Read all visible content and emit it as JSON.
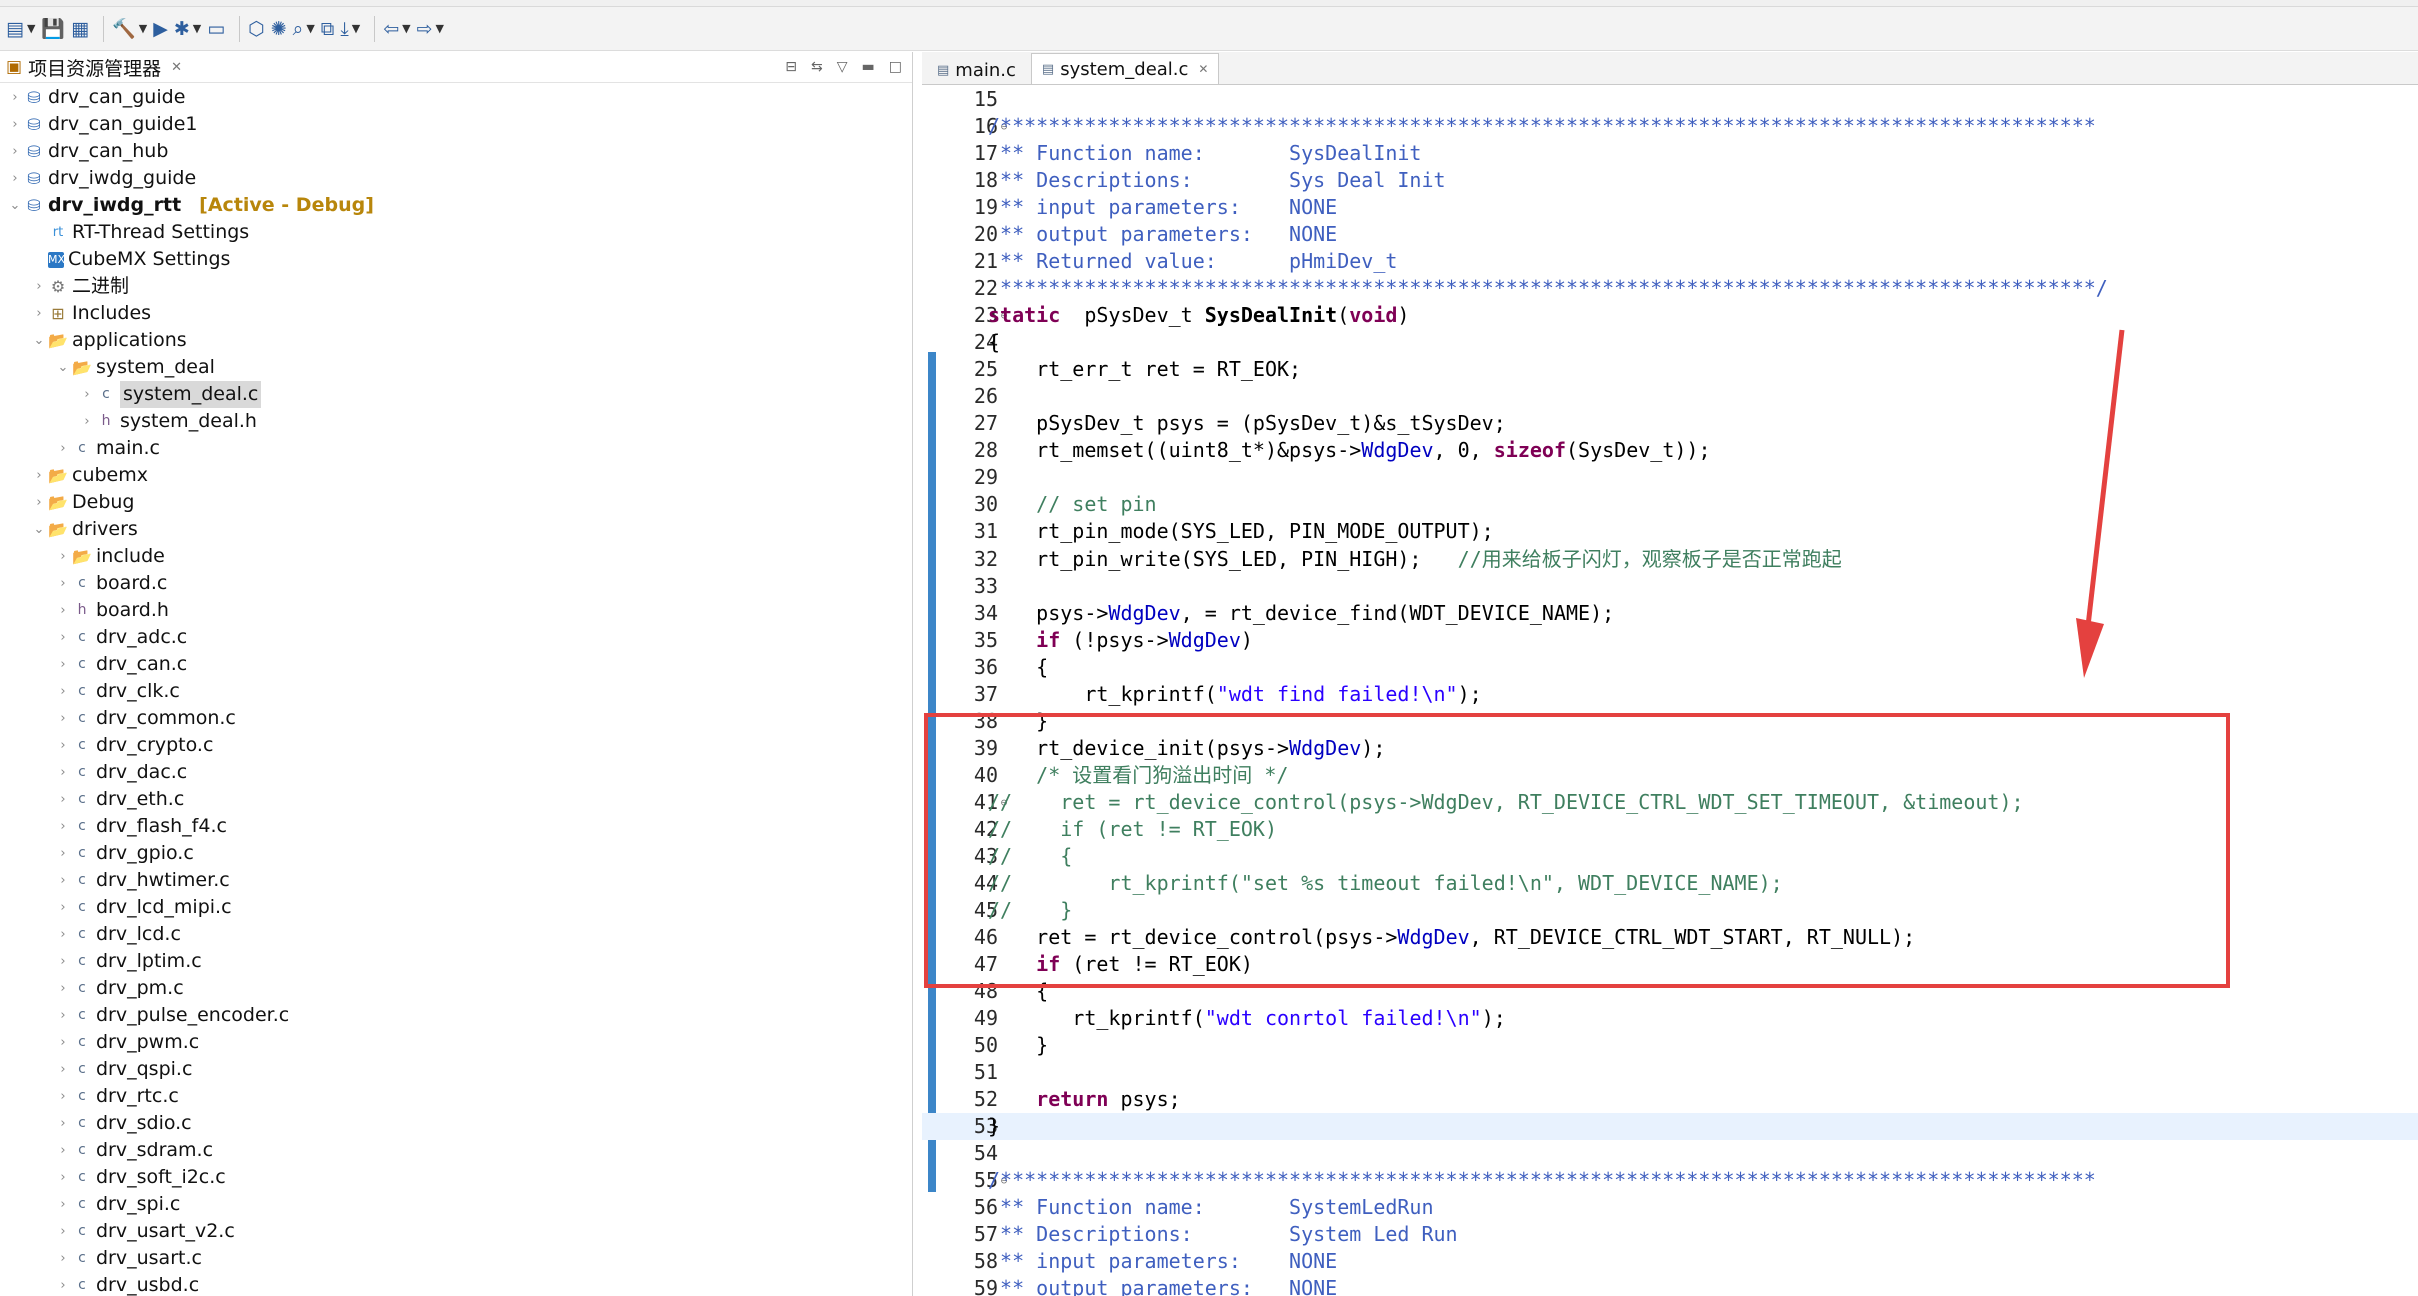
{
  "toolbar": {
    "icons": [
      "new-icon",
      "save-icon",
      "save-all-icon",
      "build-icon",
      "run-icon",
      "debug-icon",
      "monitor-icon",
      "chip-icon",
      "bug-icon",
      "search-icon",
      "package-icon",
      "download-icon",
      "back-icon",
      "forward-icon"
    ]
  },
  "left_panel": {
    "title": "项目资源管理器",
    "tree": [
      {
        "depth": 0,
        "arrow": "›",
        "icon": "proj",
        "label": "drv_can_guide"
      },
      {
        "depth": 0,
        "arrow": "›",
        "icon": "proj",
        "label": "drv_can_guide1"
      },
      {
        "depth": 0,
        "arrow": "›",
        "icon": "proj",
        "label": "drv_can_hub"
      },
      {
        "depth": 0,
        "arrow": "›",
        "icon": "proj",
        "label": "drv_iwdg_guide"
      },
      {
        "depth": 0,
        "arrow": "⌄",
        "icon": "proj",
        "label": "drv_iwdg_rtt",
        "suffix": "[Active - Debug]",
        "bold": true
      },
      {
        "depth": 1,
        "arrow": "",
        "icon": "rt",
        "label": "RT-Thread Settings"
      },
      {
        "depth": 1,
        "arrow": "",
        "icon": "mx",
        "label": "CubeMX Settings"
      },
      {
        "depth": 1,
        "arrow": "›",
        "icon": "bin",
        "label": "二进制"
      },
      {
        "depth": 1,
        "arrow": "›",
        "icon": "inc",
        "label": "Includes"
      },
      {
        "depth": 1,
        "arrow": "⌄",
        "icon": "folder",
        "label": "applications"
      },
      {
        "depth": 2,
        "arrow": "⌄",
        "icon": "folder",
        "label": "system_deal"
      },
      {
        "depth": 3,
        "arrow": "›",
        "icon": "cfile",
        "label": "system_deal.c",
        "selected": true
      },
      {
        "depth": 3,
        "arrow": "›",
        "icon": "hfile",
        "label": "system_deal.h"
      },
      {
        "depth": 2,
        "arrow": "›",
        "icon": "cfile",
        "label": "main.c"
      },
      {
        "depth": 1,
        "arrow": "›",
        "icon": "folder",
        "label": "cubemx"
      },
      {
        "depth": 1,
        "arrow": "›",
        "icon": "folder",
        "label": "Debug"
      },
      {
        "depth": 1,
        "arrow": "⌄",
        "icon": "folder",
        "label": "drivers"
      },
      {
        "depth": 2,
        "arrow": "›",
        "icon": "folder",
        "label": "include"
      },
      {
        "depth": 2,
        "arrow": "›",
        "icon": "cfile",
        "label": "board.c"
      },
      {
        "depth": 2,
        "arrow": "›",
        "icon": "hfile",
        "label": "board.h"
      },
      {
        "depth": 2,
        "arrow": "›",
        "icon": "cfile",
        "label": "drv_adc.c"
      },
      {
        "depth": 2,
        "arrow": "›",
        "icon": "cfile",
        "label": "drv_can.c"
      },
      {
        "depth": 2,
        "arrow": "›",
        "icon": "cfile",
        "label": "drv_clk.c"
      },
      {
        "depth": 2,
        "arrow": "›",
        "icon": "cfile",
        "label": "drv_common.c"
      },
      {
        "depth": 2,
        "arrow": "›",
        "icon": "cfile",
        "label": "drv_crypto.c"
      },
      {
        "depth": 2,
        "arrow": "›",
        "icon": "cfile",
        "label": "drv_dac.c"
      },
      {
        "depth": 2,
        "arrow": "›",
        "icon": "cfile",
        "label": "drv_eth.c"
      },
      {
        "depth": 2,
        "arrow": "›",
        "icon": "cfile",
        "label": "drv_flash_f4.c"
      },
      {
        "depth": 2,
        "arrow": "›",
        "icon": "cfile",
        "label": "drv_gpio.c"
      },
      {
        "depth": 2,
        "arrow": "›",
        "icon": "cfile",
        "label": "drv_hwtimer.c"
      },
      {
        "depth": 2,
        "arrow": "›",
        "icon": "cfile",
        "label": "drv_lcd_mipi.c"
      },
      {
        "depth": 2,
        "arrow": "›",
        "icon": "cfile",
        "label": "drv_lcd.c"
      },
      {
        "depth": 2,
        "arrow": "›",
        "icon": "cfile",
        "label": "drv_lptim.c"
      },
      {
        "depth": 2,
        "arrow": "›",
        "icon": "cfile",
        "label": "drv_pm.c"
      },
      {
        "depth": 2,
        "arrow": "›",
        "icon": "cfile",
        "label": "drv_pulse_encoder.c"
      },
      {
        "depth": 2,
        "arrow": "›",
        "icon": "cfile",
        "label": "drv_pwm.c"
      },
      {
        "depth": 2,
        "arrow": "›",
        "icon": "cfile",
        "label": "drv_qspi.c"
      },
      {
        "depth": 2,
        "arrow": "›",
        "icon": "cfile",
        "label": "drv_rtc.c"
      },
      {
        "depth": 2,
        "arrow": "›",
        "icon": "cfile",
        "label": "drv_sdio.c"
      },
      {
        "depth": 2,
        "arrow": "›",
        "icon": "cfile",
        "label": "drv_sdram.c"
      },
      {
        "depth": 2,
        "arrow": "›",
        "icon": "cfile",
        "label": "drv_soft_i2c.c"
      },
      {
        "depth": 2,
        "arrow": "›",
        "icon": "cfile",
        "label": "drv_spi.c"
      },
      {
        "depth": 2,
        "arrow": "›",
        "icon": "cfile",
        "label": "drv_usart_v2.c"
      },
      {
        "depth": 2,
        "arrow": "›",
        "icon": "cfile",
        "label": "drv_usart.c"
      },
      {
        "depth": 2,
        "arrow": "›",
        "icon": "cfile",
        "label": "drv_usbd.c"
      }
    ]
  },
  "editor": {
    "tabs": [
      {
        "label": "main.c",
        "active": false
      },
      {
        "label": "system_deal.c",
        "active": true
      }
    ],
    "lines": [
      {
        "n": "15",
        "segs": []
      },
      {
        "n": "16",
        "fold": true,
        "segs": [
          [
            "dc",
            "/*******************************************************************************************"
          ]
        ]
      },
      {
        "n": "17",
        "segs": [
          [
            "dc",
            " ** Function name:       SysDealInit"
          ]
        ]
      },
      {
        "n": "18",
        "segs": [
          [
            "dc",
            " ** Descriptions:        Sys Deal Init"
          ]
        ]
      },
      {
        "n": "19",
        "segs": [
          [
            "dc",
            " ** input parameters:    NONE"
          ]
        ]
      },
      {
        "n": "20",
        "segs": [
          [
            "dc",
            " ** output parameters:   NONE"
          ]
        ]
      },
      {
        "n": "21",
        "segs": [
          [
            "dc",
            " ** Returned value:      pHmiDev_t"
          ]
        ]
      },
      {
        "n": "22",
        "segs": [
          [
            "dc",
            " *******************************************************************************************/"
          ]
        ]
      },
      {
        "n": "23",
        "fold": true,
        "segs": [
          [
            "kw",
            "static"
          ],
          [
            "",
            "  pSysDev_t "
          ],
          [
            "fn",
            "SysDealInit"
          ],
          [
            "",
            "("
          ],
          [
            "kw",
            "void"
          ],
          [
            "",
            ")"
          ]
        ]
      },
      {
        "n": "24",
        "segs": [
          [
            "",
            "{"
          ]
        ]
      },
      {
        "n": "25",
        "segs": [
          [
            "",
            "    rt_err_t ret = RT_EOK;"
          ]
        ]
      },
      {
        "n": "26",
        "segs": []
      },
      {
        "n": "27",
        "segs": [
          [
            "",
            "    pSysDev_t psys = (pSysDev_t)&s_tSysDev;"
          ]
        ]
      },
      {
        "n": "28",
        "segs": [
          [
            "",
            "    rt_memset((uint8_t*)&psys->"
          ],
          [
            "fd",
            "WdgDev"
          ],
          [
            "",
            ", 0, "
          ],
          [
            "kw",
            "sizeof"
          ],
          [
            "",
            "(SysDev_t));"
          ]
        ]
      },
      {
        "n": "29",
        "segs": []
      },
      {
        "n": "30",
        "segs": [
          [
            "cm",
            "    // set pin"
          ]
        ]
      },
      {
        "n": "31",
        "segs": [
          [
            "",
            "    rt_pin_mode(SYS_LED, PIN_MODE_OUTPUT);"
          ]
        ]
      },
      {
        "n": "32",
        "segs": [
          [
            "",
            "    rt_pin_write(SYS_LED, PIN_HIGH);   "
          ],
          [
            "cm",
            "//用来给板子闪灯，观察板子是否正常跑起"
          ]
        ]
      },
      {
        "n": "33",
        "segs": []
      },
      {
        "n": "34",
        "segs": [
          [
            "",
            "    psys->"
          ],
          [
            "fd",
            "WdgDev"
          ],
          [
            "",
            ", = rt_device_find(WDT_DEVICE_NAME);"
          ]
        ]
      },
      {
        "n": "35",
        "segs": [
          [
            "kw",
            "    if"
          ],
          [
            "",
            " (!psys->"
          ],
          [
            "fd",
            "WdgDev"
          ],
          [
            "",
            ")"
          ]
        ]
      },
      {
        "n": "36",
        "segs": [
          [
            "",
            "    {"
          ]
        ]
      },
      {
        "n": "37",
        "segs": [
          [
            "",
            "        rt_kprintf("
          ],
          [
            "st",
            "\"wdt find failed!\\n\""
          ],
          [
            "",
            ");"
          ]
        ]
      },
      {
        "n": "38",
        "segs": [
          [
            "",
            "    }"
          ]
        ]
      },
      {
        "n": "39",
        "segs": [
          [
            "",
            "    rt_device_init(psys->"
          ],
          [
            "fd",
            "WdgDev"
          ],
          [
            "",
            ");"
          ]
        ]
      },
      {
        "n": "40",
        "segs": [
          [
            "cm",
            "    /* 设置看门狗溢出时间 */"
          ]
        ]
      },
      {
        "n": "41",
        "fold": true,
        "segs": [
          [
            "cm",
            "//    ret = rt_device_control(psys->WdgDev, RT_DEVICE_CTRL_WDT_SET_TIMEOUT, &timeout);"
          ]
        ]
      },
      {
        "n": "42",
        "segs": [
          [
            "cm",
            "//    if (ret != RT_EOK)"
          ]
        ]
      },
      {
        "n": "43",
        "segs": [
          [
            "cm",
            "//    {"
          ]
        ]
      },
      {
        "n": "44",
        "segs": [
          [
            "cm",
            "//        rt_kprintf(\"set %s timeout failed!\\n\", WDT_DEVICE_NAME);"
          ]
        ]
      },
      {
        "n": "45",
        "segs": [
          [
            "cm",
            "//    }"
          ]
        ]
      },
      {
        "n": "46",
        "segs": [
          [
            "",
            "    ret = rt_device_control(psys->"
          ],
          [
            "fd",
            "WdgDev"
          ],
          [
            "",
            ", RT_DEVICE_CTRL_WDT_START, RT_NULL);"
          ]
        ]
      },
      {
        "n": "47",
        "segs": [
          [
            "kw",
            "    if"
          ],
          [
            "",
            " (ret != RT_EOK)"
          ]
        ]
      },
      {
        "n": "48",
        "segs": [
          [
            "",
            "    {"
          ]
        ]
      },
      {
        "n": "49",
        "segs": [
          [
            "",
            "       rt_kprintf("
          ],
          [
            "st",
            "\"wdt conrtol failed!\\n\""
          ],
          [
            "",
            ");"
          ]
        ]
      },
      {
        "n": "50",
        "segs": [
          [
            "",
            "    }"
          ]
        ]
      },
      {
        "n": "51",
        "segs": []
      },
      {
        "n": "52",
        "segs": [
          [
            "kw",
            "    return"
          ],
          [
            "",
            " psys;"
          ]
        ]
      },
      {
        "n": "53",
        "hl": true,
        "segs": [
          [
            "",
            "}"
          ]
        ]
      },
      {
        "n": "54",
        "segs": []
      },
      {
        "n": "55",
        "fold": true,
        "segs": [
          [
            "dc",
            "/*******************************************************************************************"
          ]
        ]
      },
      {
        "n": "56",
        "segs": [
          [
            "dc",
            " ** Function name:       SystemLedRun"
          ]
        ]
      },
      {
        "n": "57",
        "segs": [
          [
            "dc",
            " ** Descriptions:        System Led Run"
          ]
        ]
      },
      {
        "n": "58",
        "segs": [
          [
            "dc",
            " ** input parameters:    NONE"
          ]
        ]
      },
      {
        "n": "59",
        "segs": [
          [
            "dc",
            " ** output parameters:   NONE"
          ]
        ]
      }
    ]
  },
  "colors": {
    "annotation": "#e4413f",
    "keyword": "#7f0055",
    "comment": "#3f7f5f",
    "doc": "#3f5fbf",
    "string": "#2a00ff",
    "field": "#0000c0"
  }
}
